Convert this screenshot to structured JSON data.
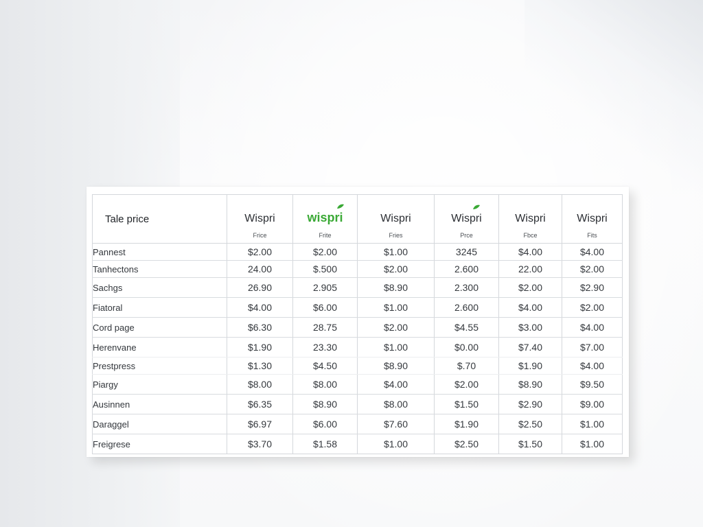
{
  "table": {
    "title": "Tale price",
    "brands": [
      {
        "name": "Wispri",
        "sub": "Frice"
      },
      {
        "name": "wispri",
        "sub": "Frite"
      },
      {
        "name": "Wispri",
        "sub": "Fries"
      },
      {
        "name": "Wispri",
        "sub": "Prce"
      },
      {
        "name": "Wispri",
        "sub": "Fbce"
      },
      {
        "name": "Wispri",
        "sub": "Fits"
      }
    ],
    "highlight_color": "#3aa935",
    "rows": [
      {
        "label": "Pannest",
        "values": [
          "$2.00",
          "$2.00",
          "$1.00",
          "3245",
          "$4.00",
          "$4.00"
        ]
      },
      {
        "label": "Tanhectons",
        "values": [
          "24.00",
          "$.500",
          "$2.00",
          "2.600",
          "22.00",
          "$2.00"
        ]
      },
      {
        "label": "Sachgs",
        "values": [
          "26.90",
          "2.905",
          "$8.90",
          "2.300",
          "$2.00",
          "$2.90"
        ]
      },
      {
        "label": "Fiatoral",
        "values": [
          "$4.00",
          "$6.00",
          "$1.00",
          "2.600",
          "$4.00",
          "$2.00"
        ]
      },
      {
        "label": "Cord page",
        "values": [
          "$6.30",
          "28.75",
          "$2.00",
          "$4.55",
          "$3.00",
          "$4.00"
        ]
      },
      {
        "label": "Herenvane",
        "values": [
          "$1.90",
          "23.30",
          "$1.00",
          "$0.00",
          "$7.40",
          "$7.00"
        ]
      },
      {
        "label": "Prestpress",
        "values": [
          "$1.30",
          "$4.50",
          "$8.90",
          "$.70",
          "$1.90",
          "$4.00"
        ]
      },
      {
        "label": "Piargy",
        "values": [
          "$8.00",
          "$8.00",
          "$4.00",
          "$2.00",
          "$8.90",
          "$9.50"
        ]
      },
      {
        "label": "Ausinnen",
        "values": [
          "$6.35",
          "$8.90",
          "$8.00",
          "$1.50",
          "$2.90",
          "$9.00"
        ]
      },
      {
        "label": "Daraggel",
        "values": [
          "$6.97",
          "$6.00",
          "$7.60",
          "$1.90",
          "$2.50",
          "$1.00"
        ]
      },
      {
        "label": "Freigrese",
        "values": [
          "$3.70",
          "$1.58",
          "$1.00",
          "$2.50",
          "$1.50",
          "$1.00"
        ]
      }
    ]
  }
}
